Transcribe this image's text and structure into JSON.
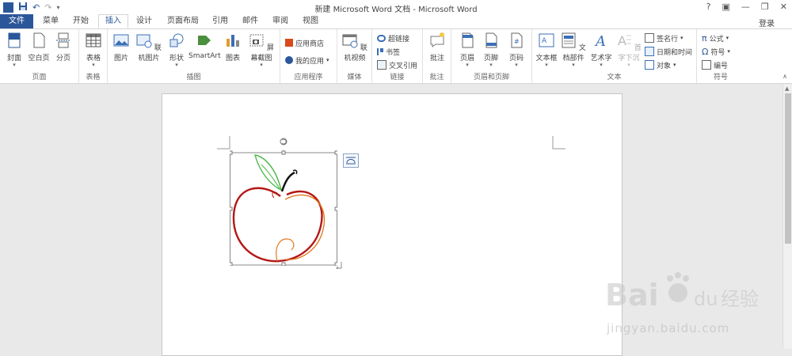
{
  "window": {
    "title": "新建 Microsoft Word 文档 - Microsoft Word",
    "help": "?",
    "ribbon_options": "▣",
    "minimize": "—",
    "restore": "❐",
    "close": "✕"
  },
  "qat": {
    "logo": "W",
    "undo": "↶",
    "redo": "↷",
    "customize": "▾"
  },
  "tabs": [
    {
      "label": "文件"
    },
    {
      "label": "菜单"
    },
    {
      "label": "开始"
    },
    {
      "label": "插入"
    },
    {
      "label": "设计"
    },
    {
      "label": "页面布局"
    },
    {
      "label": "引用"
    },
    {
      "label": "邮件"
    },
    {
      "label": "审阅"
    },
    {
      "label": "视图"
    }
  ],
  "login": "登录",
  "groups": {
    "pages": {
      "label": "页面",
      "cover": "封面",
      "blank": "空白页",
      "break": "分页"
    },
    "tables": {
      "label": "表格",
      "table": "表格"
    },
    "illustrations": {
      "label": "插图",
      "picture": "图片",
      "online_picture": "联机图片",
      "shapes": "形状",
      "smartart": "SmartArt",
      "chart": "图表",
      "screenshot": "屏幕截图"
    },
    "apps": {
      "label": "应用程序",
      "store": "应用商店",
      "my_apps": "我的应用"
    },
    "media": {
      "label": "媒体",
      "online_video": "联机视频"
    },
    "links": {
      "label": "链接",
      "hyperlink": "超链接",
      "bookmark": "书签",
      "cross_ref": "交叉引用"
    },
    "comments": {
      "label": "批注",
      "comment": "批注"
    },
    "header_footer": {
      "label": "页眉和页脚",
      "header": "页眉",
      "footer": "页脚",
      "page_number": "页码"
    },
    "text": {
      "label": "文本",
      "textbox": "文本框",
      "quick_parts": "文档部件",
      "wordart": "艺术字",
      "dropcap": "首字下沉",
      "signature": "签名行",
      "datetime": "日期和时间",
      "object": "对象"
    },
    "symbols": {
      "label": "符号",
      "equation": "公式",
      "symbol": "符号",
      "number": "编号"
    }
  },
  "watermark": {
    "text": "jingyan.baidu.com",
    "logo": "Bai",
    "logo2": "百度",
    "logo3": "经验"
  },
  "colors": {
    "accent": "#2b579a",
    "apple_red": "#b41717",
    "apple_orange": "#e07a1f",
    "leaf": "#4cb848"
  }
}
